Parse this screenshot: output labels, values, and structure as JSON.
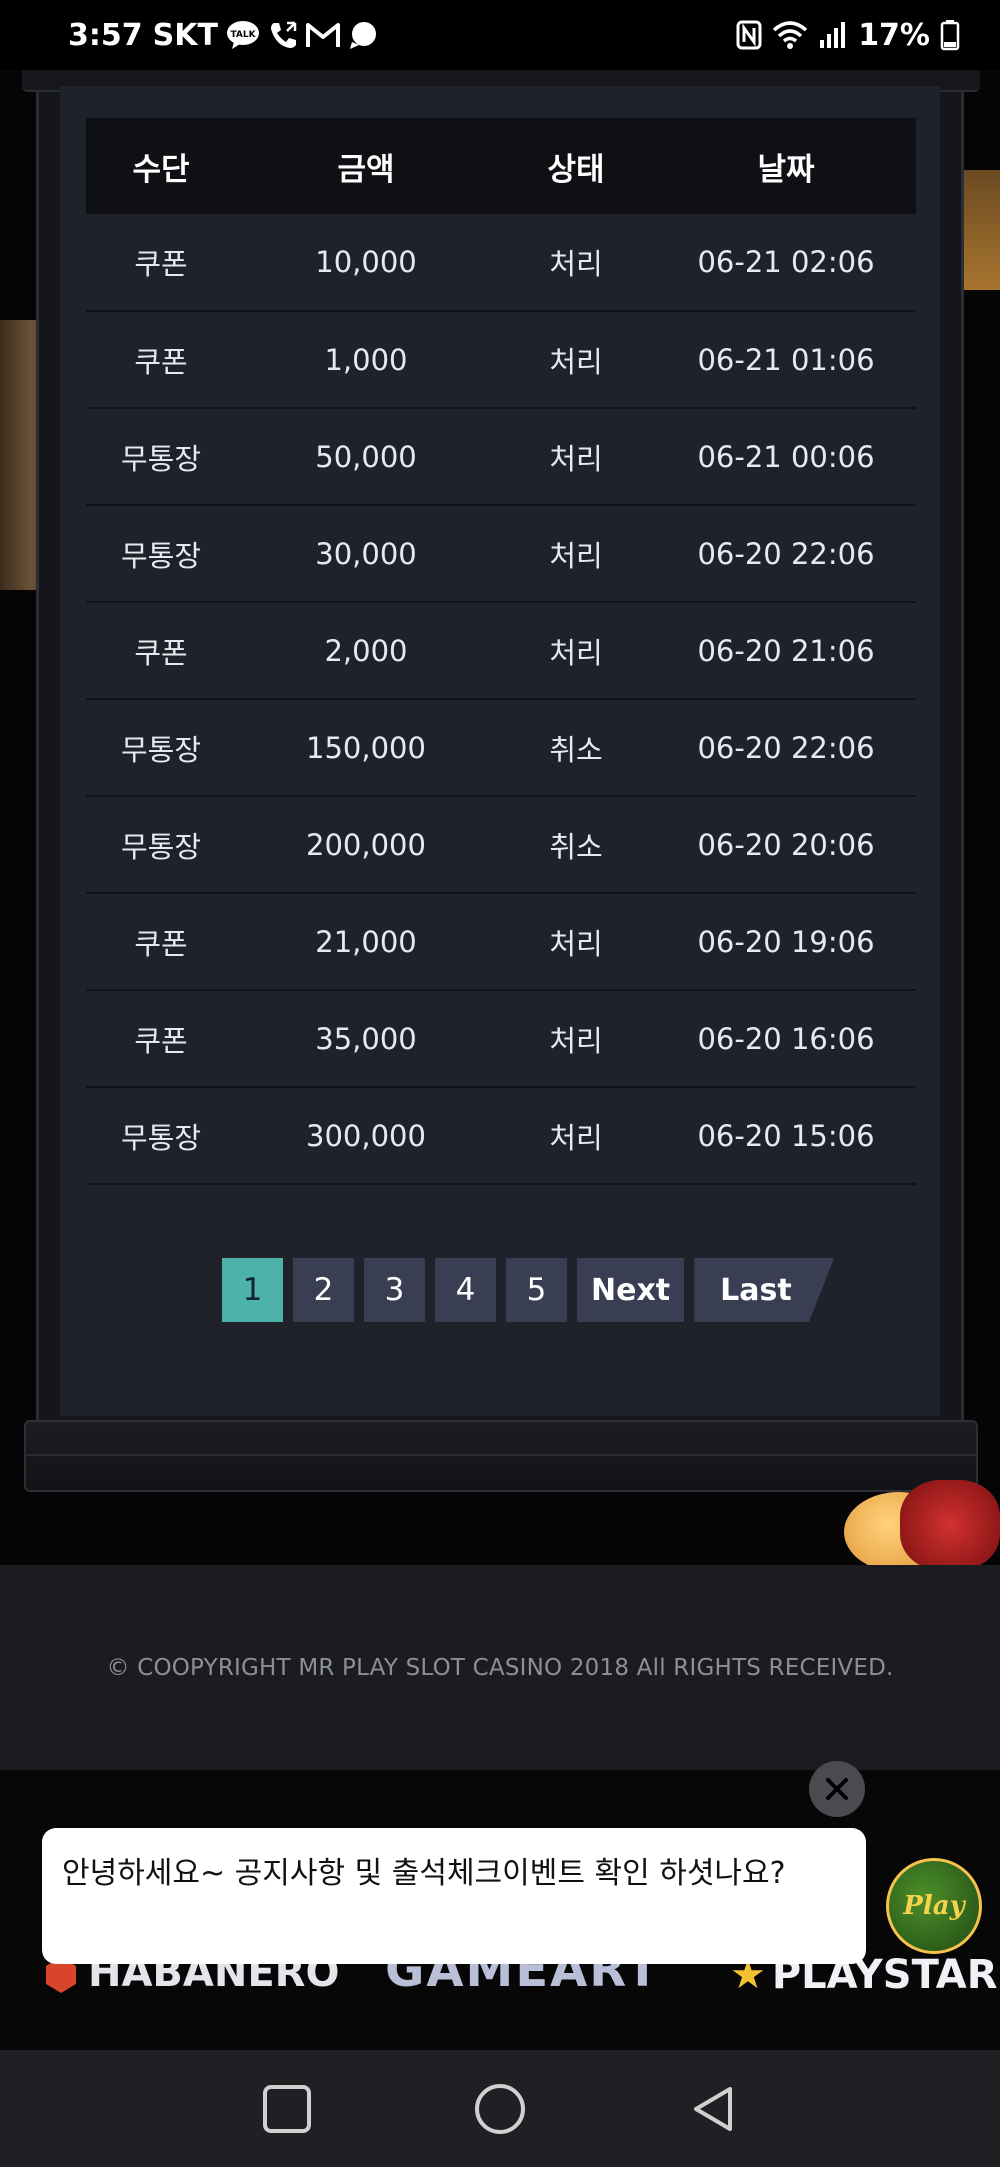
{
  "status_bar": {
    "time": "3:57",
    "carrier": "SKT",
    "battery_percent": "17%",
    "left_icons": [
      "talk-icon",
      "phone-icon",
      "gmail-icon",
      "chat-icon"
    ],
    "right_icons": [
      "nfc-icon",
      "wifi-icon",
      "signal-icon",
      "battery-icon"
    ]
  },
  "table": {
    "headers": [
      "수단",
      "금액",
      "상태",
      "날짜"
    ],
    "rows": [
      [
        "쿠폰",
        "10,000",
        "처리",
        "06-21 02:06"
      ],
      [
        "쿠폰",
        "1,000",
        "처리",
        "06-21 01:06"
      ],
      [
        "무통장",
        "50,000",
        "처리",
        "06-21 00:06"
      ],
      [
        "무통장",
        "30,000",
        "처리",
        "06-20 22:06"
      ],
      [
        "쿠폰",
        "2,000",
        "처리",
        "06-20 21:06"
      ],
      [
        "무통장",
        "150,000",
        "취소",
        "06-20 22:06"
      ],
      [
        "무통장",
        "200,000",
        "취소",
        "06-20 20:06"
      ],
      [
        "쿠폰",
        "21,000",
        "처리",
        "06-20 19:06"
      ],
      [
        "쿠폰",
        "35,000",
        "처리",
        "06-20 16:06"
      ],
      [
        "무통장",
        "300,000",
        "처리",
        "06-20 15:06"
      ]
    ]
  },
  "pagination": {
    "pages": [
      "1",
      "2",
      "3",
      "4",
      "5"
    ],
    "active": "1",
    "next_label": "Next",
    "last_label": "Last"
  },
  "footer": {
    "copyright": "© COOPYRIGHT MR PLAY SLOT CASINO 2018 All RIGHTS RECEIVED."
  },
  "providers": {
    "habanero": "HABANERO",
    "gameart": "GAMEART",
    "playstar": "PLAYSTAR"
  },
  "chat_popup": {
    "message": "안녕하세요~ 공지사항 및 출석체크이벤트 확인 하셧나요?",
    "avatar_text": "Play"
  },
  "colors": {
    "active_page": "#4db3aa",
    "page_button": "#3a3e52",
    "panel": "#1f222a",
    "header": "#0f1013"
  },
  "nav_bar": {
    "buttons": [
      "recents-icon",
      "home-icon",
      "back-icon"
    ]
  }
}
